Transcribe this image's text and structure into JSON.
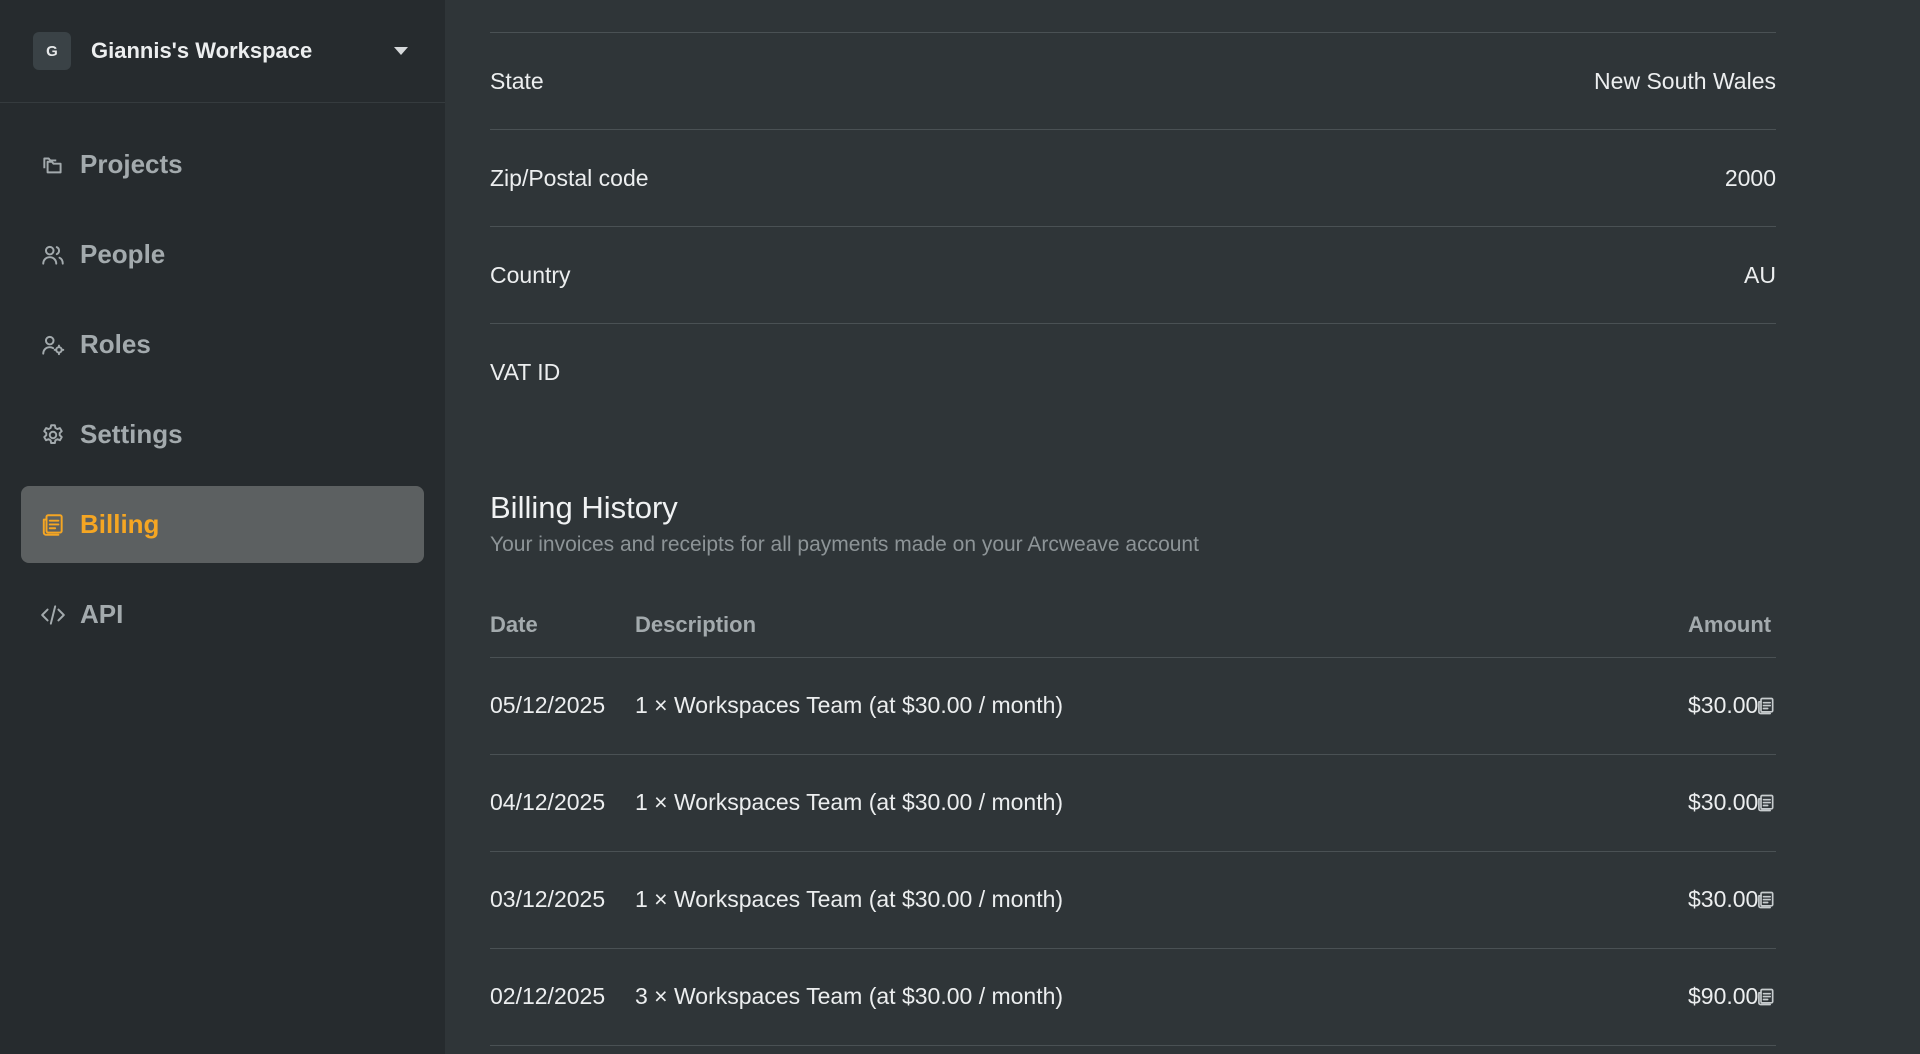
{
  "workspace": {
    "initial": "G",
    "name": "Giannis's Workspace"
  },
  "nav": {
    "projects": "Projects",
    "people": "People",
    "roles": "Roles",
    "settings": "Settings",
    "billing": "Billing",
    "api": "API"
  },
  "colors": {
    "accent": "#f5a623",
    "sidebar_bg": "#262b2e",
    "main_bg": "#2f3538"
  },
  "address": {
    "state": {
      "label": "State",
      "value": "New South Wales"
    },
    "zip": {
      "label": "Zip/Postal code",
      "value": "2000"
    },
    "country": {
      "label": "Country",
      "value": "AU"
    },
    "vat": {
      "label": "VAT ID",
      "value": ""
    }
  },
  "billing_history": {
    "title": "Billing History",
    "subtitle": "Your invoices and receipts for all payments made on your Arcweave account",
    "columns": {
      "date": "Date",
      "description": "Description",
      "amount": "Amount"
    },
    "rows": [
      {
        "date": "05/12/2025",
        "description": "1 × Workspaces Team (at $30.00 / month)",
        "amount": "$30.00"
      },
      {
        "date": "04/12/2025",
        "description": "1 × Workspaces Team (at $30.00 / month)",
        "amount": "$30.00"
      },
      {
        "date": "03/12/2025",
        "description": "1 × Workspaces Team (at $30.00 / month)",
        "amount": "$30.00"
      },
      {
        "date": "02/12/2025",
        "description": "3 × Workspaces Team (at $30.00 / month)",
        "amount": "$90.00"
      }
    ]
  }
}
